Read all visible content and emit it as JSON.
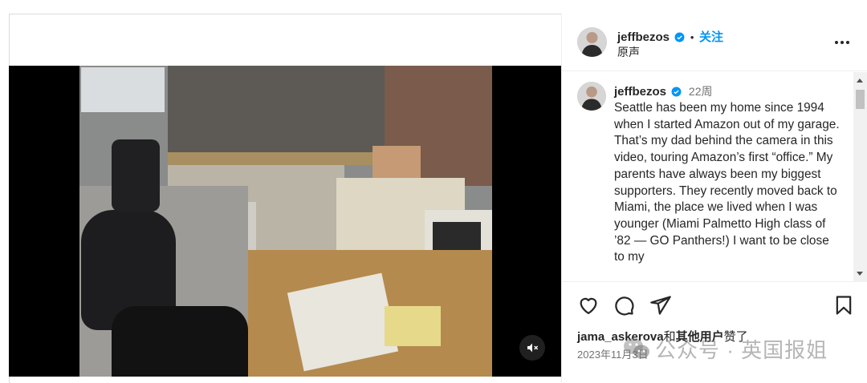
{
  "post": {
    "username": "jeffbezos",
    "follow_label": "关注",
    "separator": "•",
    "audio_label": "原声",
    "caption": {
      "username": "jeffbezos",
      "time_ago": "22周",
      "text": "Seattle has been my home since 1994 when I started Amazon out of my garage. That’s my dad behind the camera in this video, touring Amazon’s first “office.” My parents have always been my biggest supporters. They recently moved back to Miami, the place we lived when I was younger (Miami Palmetto High class of ’82 — GO Panthers!) I want to be close to my"
    },
    "likes": {
      "liker": "jama_askerova",
      "and_text": "和",
      "others": "其他用户",
      "suffix": "赞了"
    },
    "date": "2023年11月3日"
  },
  "icons": {
    "more": "more-horizontal-icon",
    "verified": "verified-badge-icon",
    "like": "heart-icon",
    "comment": "comment-icon",
    "share": "share-icon",
    "save": "bookmark-icon",
    "mute": "audio-muted-icon"
  },
  "watermark": {
    "text": "公众号 · 英国报姐"
  },
  "colors": {
    "accent": "#0095f6",
    "verified": "#0095f6",
    "text": "#262626",
    "secondary": "#737373"
  }
}
